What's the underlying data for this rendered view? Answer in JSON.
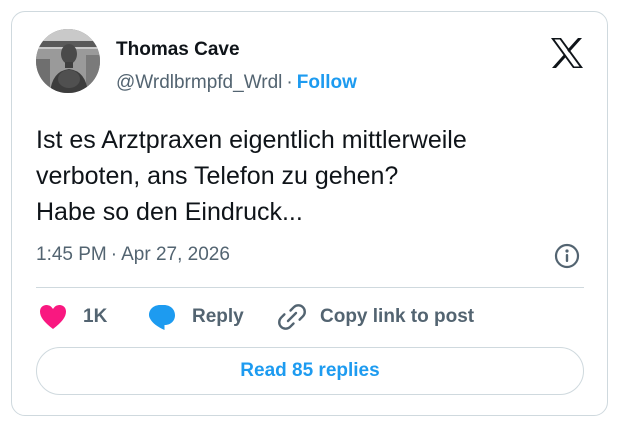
{
  "author": {
    "display_name": "Thomas Cave",
    "handle": "@Wrdlbrmpfd_Wrdl",
    "separator": "·",
    "follow_label": "Follow"
  },
  "tweet": {
    "lines": [
      "Ist es Arztpraxen eigentlich mittlerweile",
      "verboten, ans Telefon zu gehen?",
      "Habe so den Eindruck..."
    ],
    "time": "1:45 PM",
    "separator": "·",
    "date": "Apr 27, 2026"
  },
  "actions": {
    "like_count": "1K",
    "reply_label": "Reply",
    "copy_label": "Copy link to post"
  },
  "read_replies_label": "Read 85 replies",
  "icons": {
    "brand": "x-logo-icon",
    "info": "info-icon",
    "like": "heart-icon",
    "reply": "speech-bubble-icon",
    "copy": "link-icon"
  },
  "colors": {
    "accent": "#1d9bf0",
    "like": "#f91880",
    "text": "#0f1419",
    "secondary": "#536471",
    "border": "#cfd9de"
  }
}
